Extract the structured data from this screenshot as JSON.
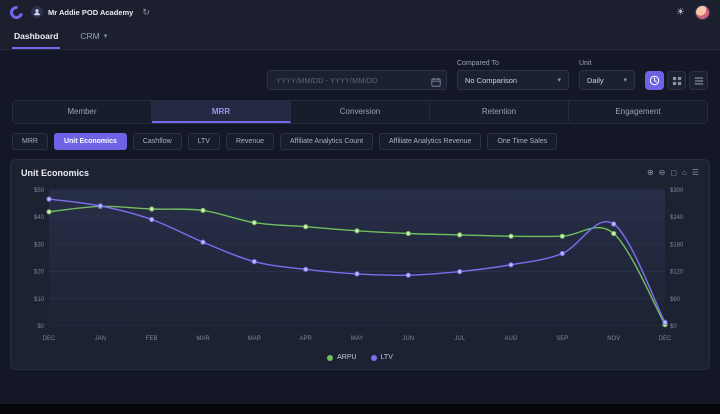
{
  "topbar": {
    "workspace_name": "Mr Addie POD Academy"
  },
  "nav": {
    "tabs": [
      {
        "label": "Dashboard",
        "active": true
      },
      {
        "label": "CRM",
        "active": false
      }
    ]
  },
  "filters": {
    "date_placeholder": "YYYY/MM/DD - YYYY/MM/DD",
    "compared_to": {
      "label": "Compared To",
      "value": "No Comparison"
    },
    "unit": {
      "label": "Unit",
      "value": "Daily"
    }
  },
  "main_tabs": [
    {
      "label": "Member",
      "active": false
    },
    {
      "label": "MRR",
      "active": true
    },
    {
      "label": "Conversion",
      "active": false
    },
    {
      "label": "Retention",
      "active": false
    },
    {
      "label": "Engagement",
      "active": false
    }
  ],
  "sub_tabs": [
    {
      "label": "MRR",
      "active": false
    },
    {
      "label": "Unit Economics",
      "active": true
    },
    {
      "label": "Cashflow",
      "active": false
    },
    {
      "label": "LTV",
      "active": false
    },
    {
      "label": "Revenue",
      "active": false
    },
    {
      "label": "Affiliate Analytics Count",
      "active": false
    },
    {
      "label": "Affiliate Analytics Revenue",
      "active": false
    },
    {
      "label": "One Time Sales",
      "active": false
    }
  ],
  "chart": {
    "title": "Unit Economics"
  },
  "icons": {
    "refresh": "↻",
    "sun": "☀",
    "chevron": "▾",
    "zoom_in": "⊕",
    "zoom_out": "⊖",
    "selection": "◻",
    "home": "⌂",
    "menu": "☰"
  },
  "colors": {
    "accent": "#6e62e5",
    "arpu_green": "#6fbf5f",
    "ltv_purple": "#7a6ff0"
  },
  "chart_data": {
    "type": "line",
    "title": "Unit Economics",
    "categories": [
      "DEC",
      "JAN",
      "FEB",
      "MAR",
      "MAR",
      "APR",
      "MAY",
      "JUN",
      "JUL",
      "AUG",
      "SEP",
      "NOV",
      "DEC"
    ],
    "y_left": {
      "min": 0,
      "max": 50,
      "ticks": [
        0,
        10,
        20,
        30,
        40,
        50
      ],
      "prefix": "$"
    },
    "y_right": {
      "min": 0,
      "max": 300,
      "ticks": [
        0,
        60,
        120,
        180,
        240,
        300
      ],
      "prefix": "$"
    },
    "grid": true,
    "legend_position": "bottom",
    "series": [
      {
        "name": "ARPU",
        "axis": "left",
        "color": "#6fbf5f",
        "marker": "#d7ecb8",
        "values": [
          42,
          44,
          43,
          42.5,
          38,
          36.5,
          35,
          34,
          33.5,
          33,
          33,
          34,
          0.5
        ]
      },
      {
        "name": "LTV",
        "axis": "right",
        "color": "#7a6ff0",
        "marker": "#c3bdf7",
        "values": [
          280,
          265,
          235,
          185,
          142,
          125,
          115,
          112,
          120,
          135,
          160,
          225,
          8
        ]
      }
    ]
  }
}
